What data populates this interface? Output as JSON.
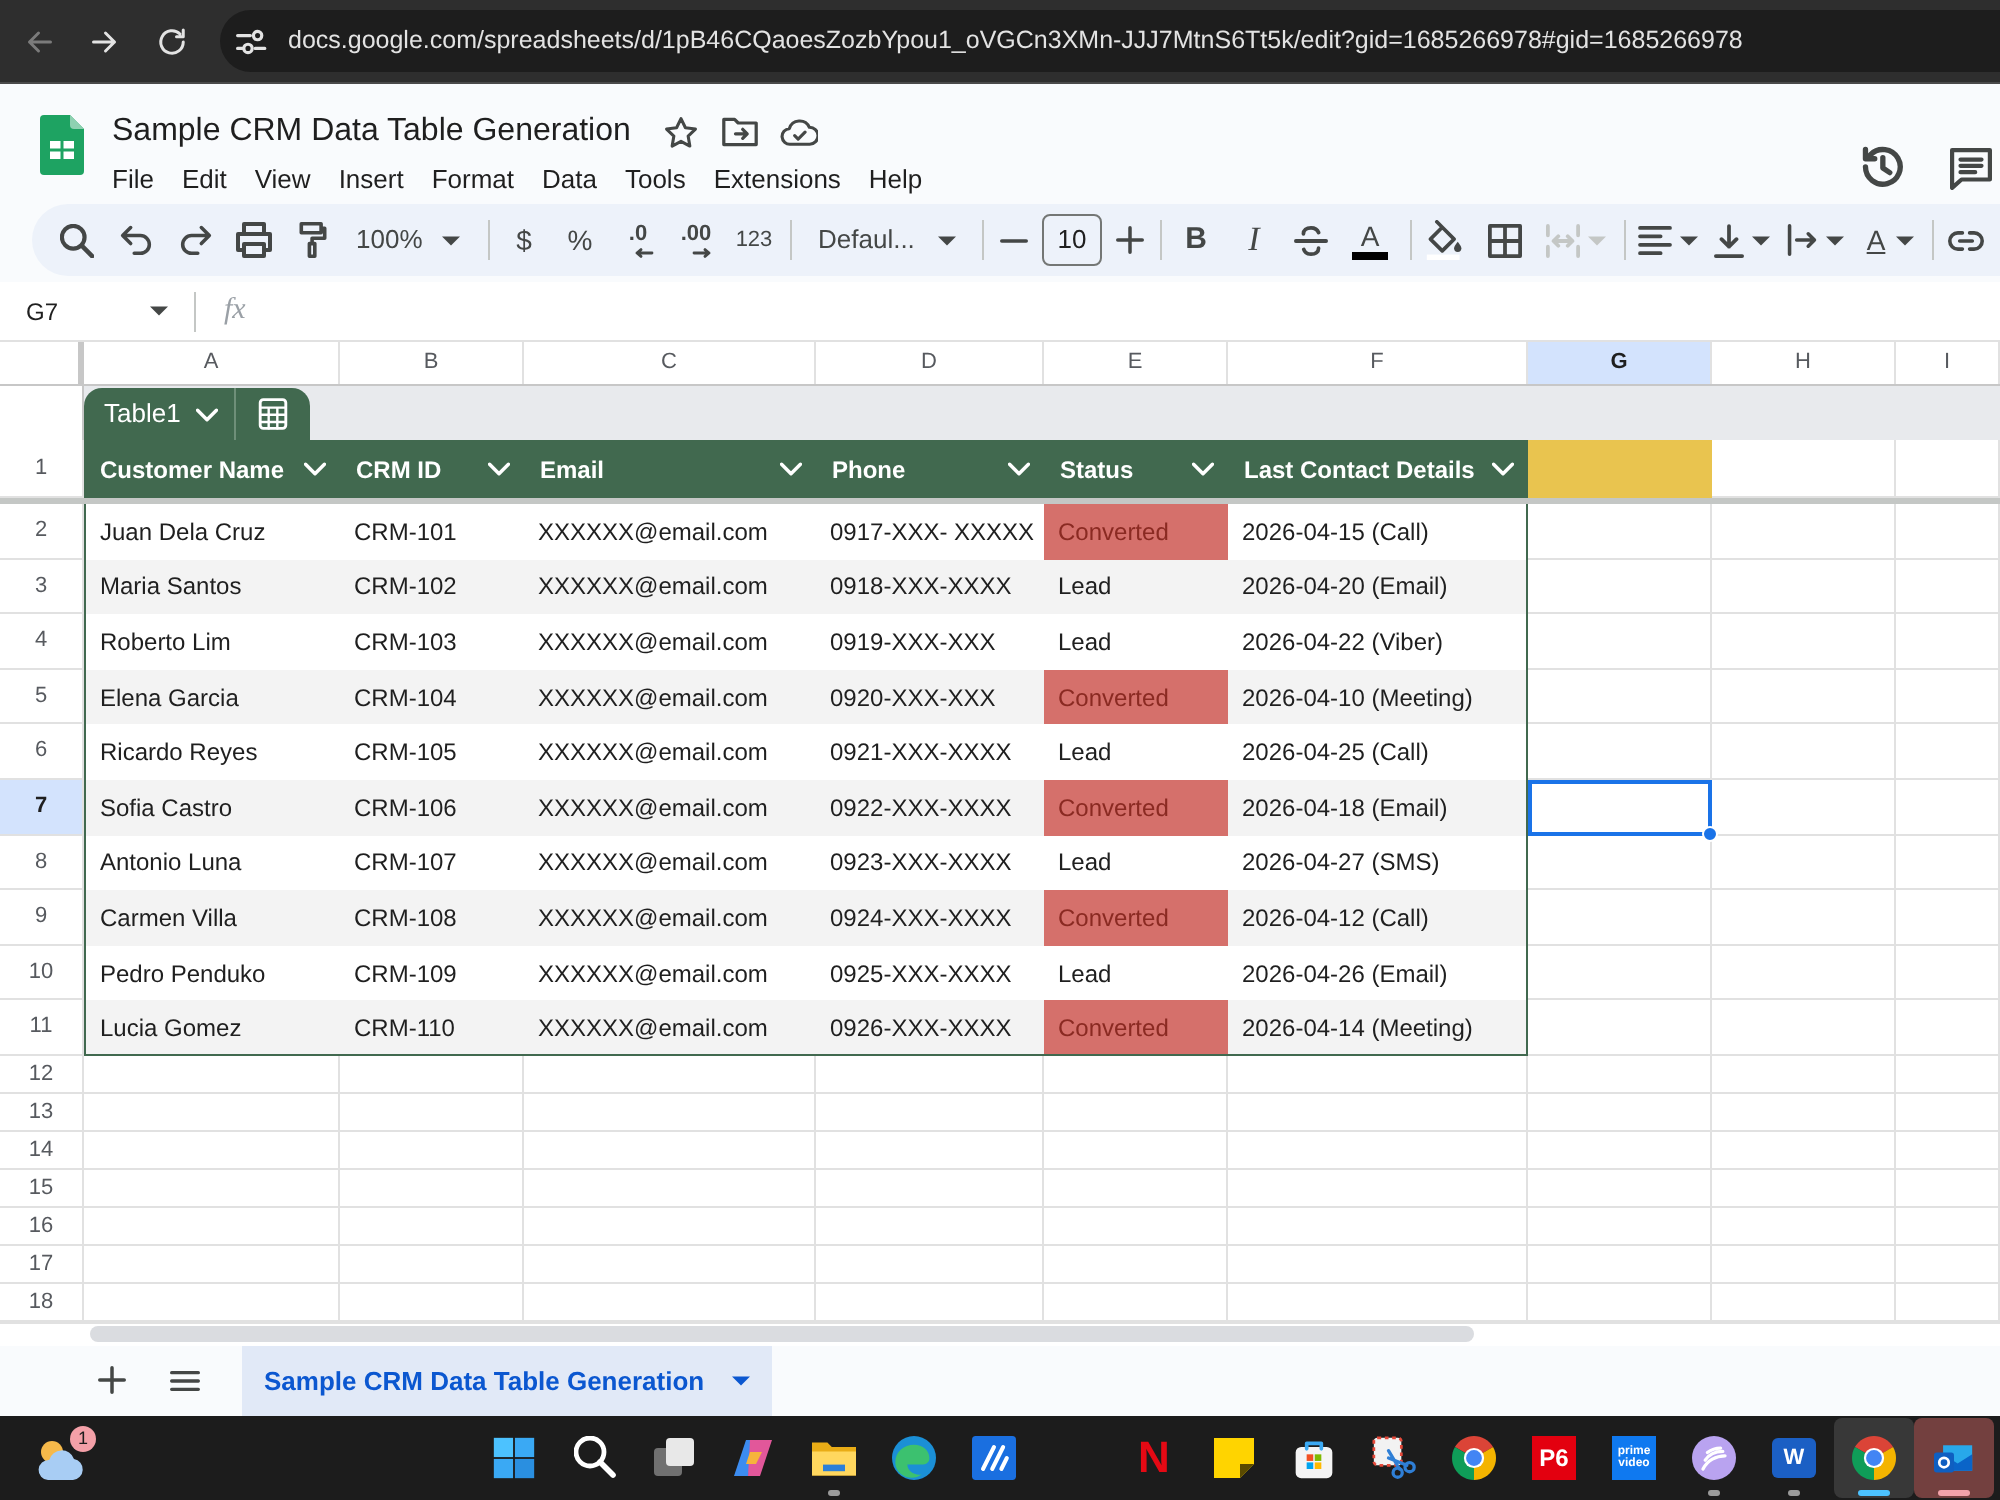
{
  "browser": {
    "url": "docs.google.com/spreadsheets/d/1pB46CQaoesZozbYpou1_oVGCn3XMn-JJJ7MtnS6Tt5k/edit?gid=1685266978#gid=1685266978",
    "back_disabled": true
  },
  "document": {
    "title": "Sample CRM Data Table Generation",
    "menu": [
      "File",
      "Edit",
      "View",
      "Insert",
      "Format",
      "Data",
      "Tools",
      "Extensions",
      "Help"
    ]
  },
  "toolbar": {
    "zoom": "100%",
    "currency": "$",
    "percent": "%",
    "decrease_decimals": ".0",
    "increase_decimals": ".00",
    "number_format": "123",
    "font": "Defaul...",
    "font_size": "10",
    "bold": "B",
    "italic": "I",
    "text_color": "A",
    "text_rotation": "A",
    "merge_disabled": true
  },
  "formula_bar": {
    "cell_reference": "G7",
    "function_label": "fx"
  },
  "sheet": {
    "columns": [
      {
        "label": "A",
        "selected": false
      },
      {
        "label": "B",
        "selected": false
      },
      {
        "label": "C",
        "selected": false
      },
      {
        "label": "D",
        "selected": false
      },
      {
        "label": "E",
        "selected": false
      },
      {
        "label": "F",
        "selected": false
      },
      {
        "label": "G",
        "selected": true
      },
      {
        "label": "H",
        "selected": false
      },
      {
        "label": "I",
        "selected": false
      }
    ],
    "rows": [
      {
        "label": "1",
        "selected": false
      },
      {
        "label": "2",
        "selected": false
      },
      {
        "label": "3",
        "selected": false
      },
      {
        "label": "4",
        "selected": false
      },
      {
        "label": "5",
        "selected": false
      },
      {
        "label": "6",
        "selected": false
      },
      {
        "label": "7",
        "selected": true
      },
      {
        "label": "8",
        "selected": false
      },
      {
        "label": "9",
        "selected": false
      },
      {
        "label": "10",
        "selected": false
      },
      {
        "label": "11",
        "selected": false
      },
      {
        "label": "12",
        "selected": false
      },
      {
        "label": "13",
        "selected": false
      },
      {
        "label": "14",
        "selected": false
      },
      {
        "label": "15",
        "selected": false
      },
      {
        "label": "16",
        "selected": false
      },
      {
        "label": "17",
        "selected": false
      },
      {
        "label": "18",
        "selected": false
      }
    ],
    "g1_filled": true,
    "table": {
      "name": "Table1",
      "columns": [
        "Customer Name",
        "CRM ID",
        "Email",
        "Phone",
        "Status",
        "Last Contact Details"
      ],
      "rows": [
        {
          "customer_name": "Juan Dela Cruz",
          "crm_id": "CRM-101",
          "email": "XXXXXX@email.com",
          "phone": "0917-XXX- XXXXX",
          "status": "Converted",
          "status_highlighted": true,
          "last_contact": "2026-04-15 (Call)"
        },
        {
          "customer_name": "Maria Santos",
          "crm_id": "CRM-102",
          "email": "XXXXXX@email.com",
          "phone": "0918-XXX-XXXX",
          "status": "Lead",
          "status_highlighted": false,
          "last_contact": "2026-04-20 (Email)"
        },
        {
          "customer_name": "Roberto Lim",
          "crm_id": "CRM-103",
          "email": "XXXXXX@email.com",
          "phone": "0919-XXX-XXX",
          "status": "Lead",
          "status_highlighted": false,
          "last_contact": "2026-04-22 (Viber)"
        },
        {
          "customer_name": "Elena Garcia",
          "crm_id": "CRM-104",
          "email": "XXXXXX@email.com",
          "phone": "0920-XXX-XXX",
          "status": "Converted",
          "status_highlighted": true,
          "last_contact": "2026-04-10 (Meeting)"
        },
        {
          "customer_name": "Ricardo Reyes",
          "crm_id": "CRM-105",
          "email": "XXXXXX@email.com",
          "phone": "0921-XXX-XXXX",
          "status": "Lead",
          "status_highlighted": false,
          "last_contact": "2026-04-25 (Call)"
        },
        {
          "customer_name": "Sofia Castro",
          "crm_id": "CRM-106",
          "email": "XXXXXX@email.com",
          "phone": "0922-XXX-XXXX",
          "status": "Converted",
          "status_highlighted": true,
          "last_contact": "2026-04-18 (Email)"
        },
        {
          "customer_name": "Antonio Luna",
          "crm_id": "CRM-107",
          "email": "XXXXXX@email.com",
          "phone": "0923-XXX-XXXX",
          "status": "Lead",
          "status_highlighted": false,
          "last_contact": "2026-04-27 (SMS)"
        },
        {
          "customer_name": "Carmen Villa",
          "crm_id": "CRM-108",
          "email": "XXXXXX@email.com",
          "phone": "0924-XXX-XXXX",
          "status": "Converted",
          "status_highlighted": true,
          "last_contact": "2026-04-12 (Call)"
        },
        {
          "customer_name": "Pedro Penduko",
          "crm_id": "CRM-109",
          "email": "XXXXXX@email.com",
          "phone": "0925-XXX-XXXX",
          "status": "Lead",
          "status_highlighted": false,
          "last_contact": "2026-04-26 (Email)"
        },
        {
          "customer_name": "Lucia Gomez",
          "crm_id": "CRM-110",
          "email": "XXXXXX@email.com",
          "phone": "0926-XXX-XXXX",
          "status": "Converted",
          "status_highlighted": true,
          "last_contact": "2026-04-14 (Meeting)"
        }
      ]
    }
  },
  "sheet_tabs": [
    {
      "label": "Sample CRM Data Table Generation",
      "selected": true
    }
  ],
  "taskbar": {
    "weather_badge": "1",
    "center": [
      {
        "kind": "start",
        "running": false,
        "focused": false,
        "attention": false
      },
      {
        "kind": "search",
        "running": false,
        "focused": false,
        "attention": false
      },
      {
        "kind": "taskview",
        "running": false,
        "focused": false,
        "attention": false
      },
      {
        "kind": "copilot",
        "running": false,
        "focused": false,
        "attention": false
      },
      {
        "kind": "files",
        "running": true,
        "focused": false,
        "attention": false
      },
      {
        "kind": "edge",
        "running": false,
        "focused": false,
        "attention": false
      },
      {
        "kind": "app",
        "running": false,
        "focused": false,
        "attention": false
      }
    ],
    "pinned": [
      {
        "kind": "netflix",
        "label": "N",
        "running": false,
        "focused": false,
        "attention": false
      },
      {
        "kind": "sticky",
        "running": false,
        "focused": false,
        "attention": false
      },
      {
        "kind": "store",
        "running": false,
        "focused": false,
        "attention": false
      },
      {
        "kind": "snip",
        "running": false,
        "focused": false,
        "attention": false
      },
      {
        "kind": "chrome",
        "running": false,
        "focused": false,
        "attention": false
      },
      {
        "kind": "p6",
        "label": "P6",
        "running": false,
        "focused": false,
        "attention": false
      },
      {
        "kind": "prime",
        "label": "prime video",
        "running": false,
        "focused": false,
        "attention": false
      },
      {
        "kind": "torrent",
        "running": true,
        "focused": false,
        "attention": false
      },
      {
        "kind": "word",
        "label": "W",
        "running": true,
        "focused": false,
        "attention": false
      },
      {
        "kind": "chrome",
        "running": true,
        "focused": true,
        "attention": false
      },
      {
        "kind": "outlook",
        "running": true,
        "focused": false,
        "attention": true
      }
    ]
  }
}
